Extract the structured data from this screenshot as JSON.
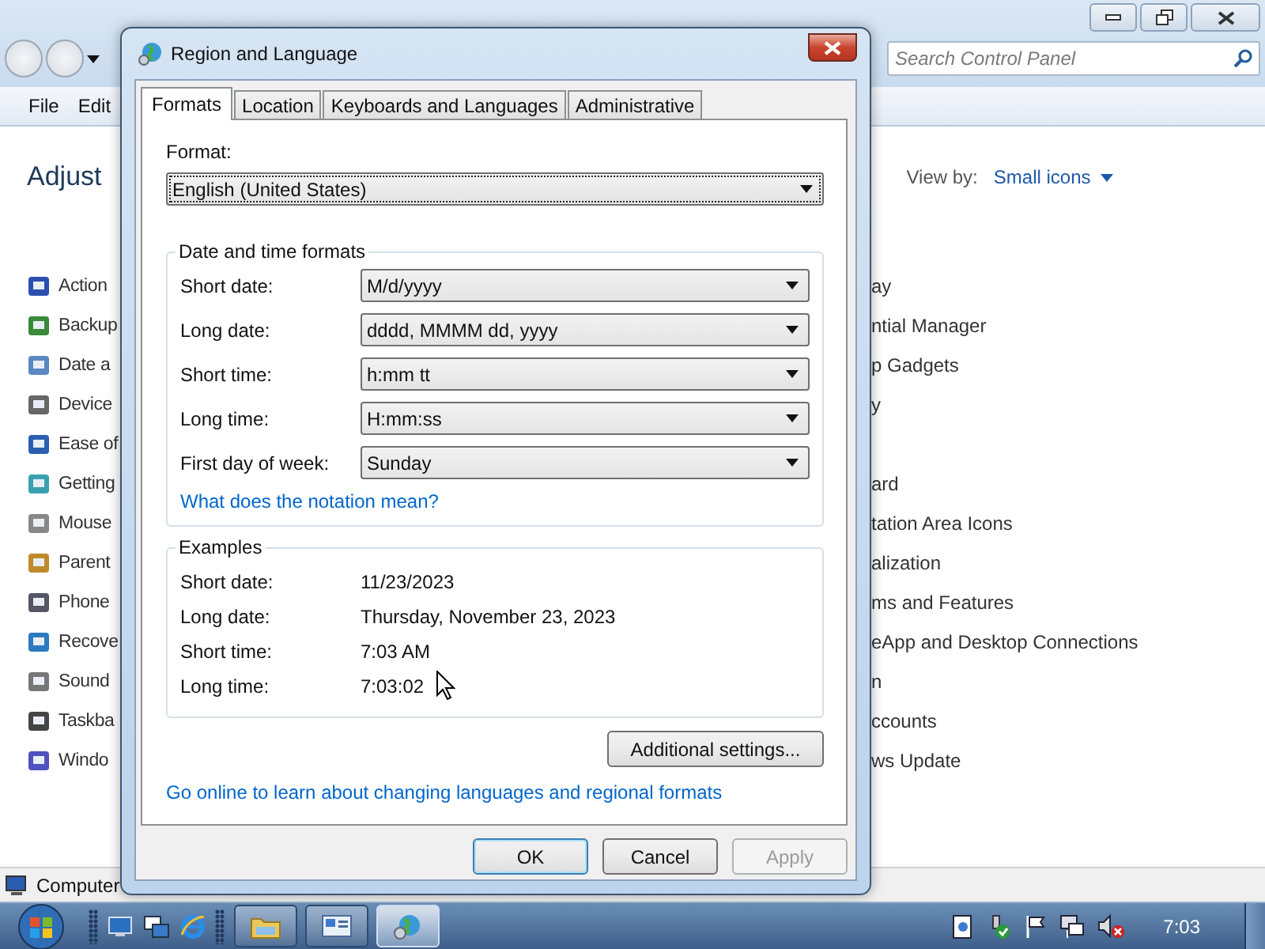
{
  "control_panel": {
    "search": {
      "placeholder": "Search Control Panel"
    },
    "menu": [
      "File",
      "Edit"
    ],
    "heading": "Adjust",
    "view_by": {
      "label": "View by:",
      "value": "Small icons"
    },
    "rows": [
      {
        "left": "Action",
        "right": "ay"
      },
      {
        "left": "Backup",
        "right": "ntial Manager"
      },
      {
        "left": "Date a",
        "right": "p Gadgets"
      },
      {
        "left": "Device",
        "right": "y"
      },
      {
        "left": "Ease of"
      },
      {
        "left": "Getting",
        "right": "ard"
      },
      {
        "left": "Mouse",
        "right": "tation Area Icons"
      },
      {
        "left": "Parent",
        "right": "alization"
      },
      {
        "left": "Phone",
        "right": "ms and Features"
      },
      {
        "left": "Recove",
        "right": "eApp and Desktop Connections"
      },
      {
        "left": "Sound",
        "right": "n"
      },
      {
        "left": "Taskba",
        "right": "ccounts"
      },
      {
        "left": "Windo",
        "right": "ws Update"
      }
    ],
    "status_bar": "Computer"
  },
  "dialog": {
    "title": "Region and Language",
    "tabs": [
      {
        "label": "Formats",
        "selected": true
      },
      {
        "label": "Location",
        "selected": false
      },
      {
        "label": "Keyboards and Languages",
        "selected": false
      },
      {
        "label": "Administrative",
        "selected": false
      }
    ],
    "format": {
      "label": "Format:",
      "value": "English (United States)"
    },
    "date_time_formats": {
      "title": "Date and time formats",
      "rows": [
        {
          "label": "Short date:",
          "value": "M/d/yyyy"
        },
        {
          "label": "Long date:",
          "value": "dddd, MMMM dd, yyyy"
        },
        {
          "label": "Short time:",
          "value": "h:mm tt"
        },
        {
          "label": "Long time:",
          "value": "H:mm:ss"
        },
        {
          "label": "First day of week:",
          "value": "Sunday"
        }
      ],
      "link": "What does the notation mean?"
    },
    "examples": {
      "title": "Examples",
      "rows": [
        {
          "label": "Short date:",
          "value": "11/23/2023"
        },
        {
          "label": "Long date:",
          "value": "Thursday, November 23, 2023"
        },
        {
          "label": "Short time:",
          "value": "7:03 AM"
        },
        {
          "label": "Long time:",
          "value": "7:03:02"
        }
      ]
    },
    "additional_button": "Additional settings...",
    "online_link": "Go online to learn about changing languages and regional formats",
    "buttons": [
      {
        "label": "OK",
        "default": true,
        "disabled": false
      },
      {
        "label": "Cancel",
        "default": false,
        "disabled": false
      },
      {
        "label": "Apply",
        "default": false,
        "disabled": true
      }
    ]
  },
  "taskbar": {
    "buttons": [
      {
        "kind": "folder",
        "selected": false
      },
      {
        "kind": "control-panel",
        "selected": false
      },
      {
        "kind": "globe",
        "selected": true
      }
    ],
    "clock": "7:03"
  }
}
